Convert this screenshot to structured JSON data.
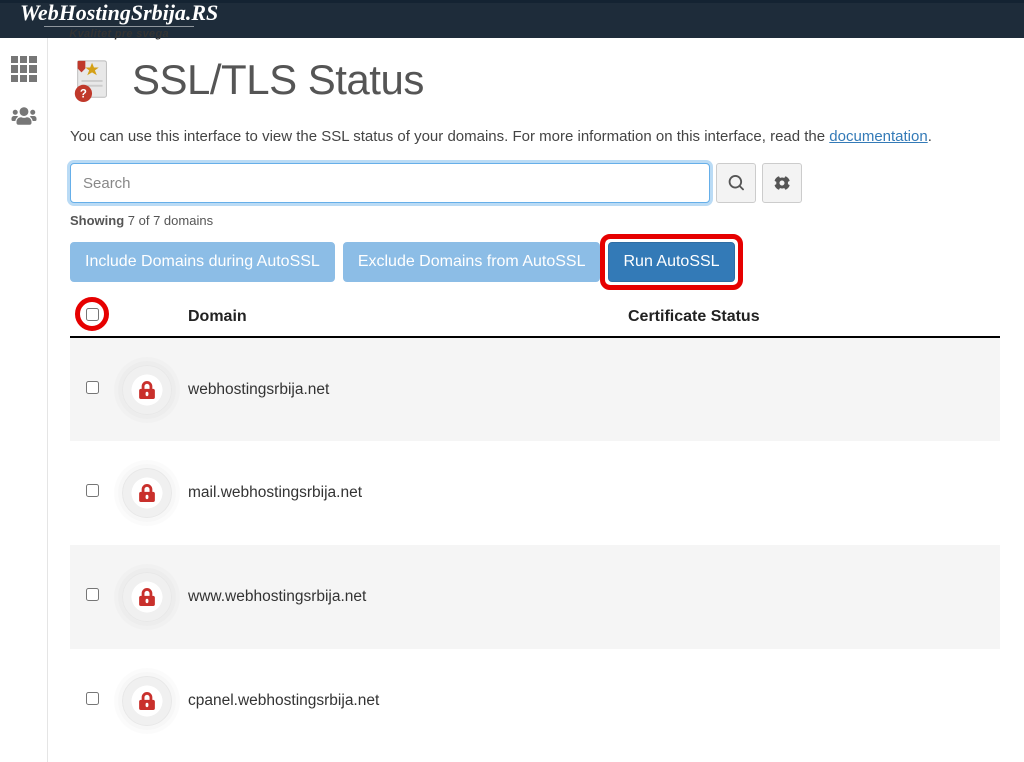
{
  "brand": {
    "name": "WebHostingSrbija.RS",
    "tagline": "Kvalitet pre svega"
  },
  "page": {
    "title": "SSL/TLS Status",
    "intro_prefix": "You can use this interface to view the SSL status of your domains. For more information on this interface, read the ",
    "intro_link": "documentation",
    "intro_suffix": "."
  },
  "search": {
    "placeholder": "Search"
  },
  "counter": {
    "label": "Showing",
    "text": "7 of 7 domains"
  },
  "actions": {
    "include": "Include Domains during AutoSSL",
    "exclude": "Exclude Domains from AutoSSL",
    "run": "Run AutoSSL"
  },
  "table": {
    "headers": {
      "domain": "Domain",
      "status": "Certificate Status"
    },
    "rows": [
      {
        "domain": "webhostingsrbija.net"
      },
      {
        "domain": "mail.webhostingsrbija.net"
      },
      {
        "domain": "www.webhostingsrbija.net"
      },
      {
        "domain": "cpanel.webhostingsrbija.net"
      }
    ]
  }
}
